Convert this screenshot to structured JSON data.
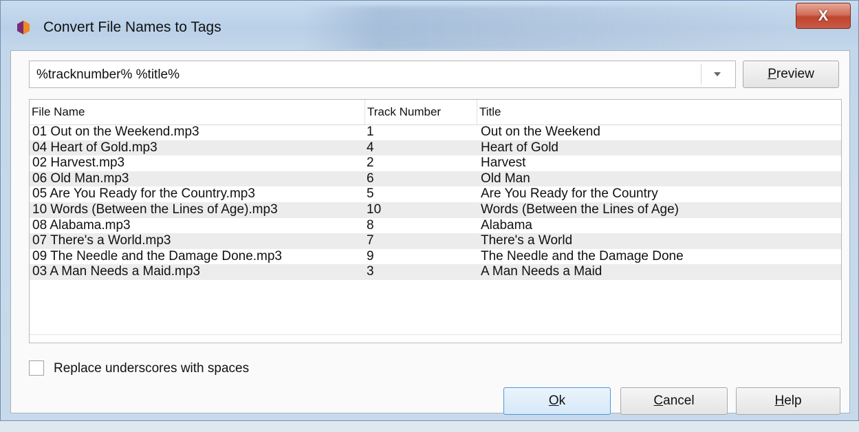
{
  "window": {
    "title": "Convert File Names to Tags",
    "close_label": "X"
  },
  "format": {
    "value": "%tracknumber% %title%"
  },
  "buttons": {
    "preview": {
      "accel": "P",
      "rest": "review"
    },
    "ok": {
      "accel": "O",
      "rest": "k"
    },
    "cancel": {
      "accel": "C",
      "rest": "ancel"
    },
    "help": {
      "accel": "H",
      "rest": "elp"
    }
  },
  "table": {
    "columns": [
      "File Name",
      "Track Number",
      "Title"
    ],
    "rows": [
      [
        "01 Out on the Weekend.mp3",
        "1",
        "Out on the Weekend"
      ],
      [
        "04 Heart of Gold.mp3",
        "4",
        "Heart of Gold"
      ],
      [
        "02 Harvest.mp3",
        "2",
        "Harvest"
      ],
      [
        "06 Old Man.mp3",
        "6",
        "Old Man"
      ],
      [
        "05 Are You Ready for the Country.mp3",
        "5",
        "Are You Ready for the Country"
      ],
      [
        "10 Words (Between the Lines of Age).mp3",
        "10",
        "Words (Between the Lines of Age)"
      ],
      [
        "08 Alabama.mp3",
        "8",
        "Alabama"
      ],
      [
        "07 There's a World.mp3",
        "7",
        "There's a World"
      ],
      [
        "09 The Needle and the Damage Done.mp3",
        "9",
        "The Needle and the Damage Done"
      ],
      [
        "03 A Man Needs a Maid.mp3",
        "3",
        "A Man Needs a Maid"
      ]
    ]
  },
  "options": {
    "replace_underscores_label": "Replace underscores with spaces",
    "replace_underscores_checked": false
  },
  "icons": {
    "app": "app-logo-icon",
    "dropdown": "chevron-down-icon"
  },
  "colors": {
    "accent": "#4f96d6",
    "close": "#c0452e"
  }
}
